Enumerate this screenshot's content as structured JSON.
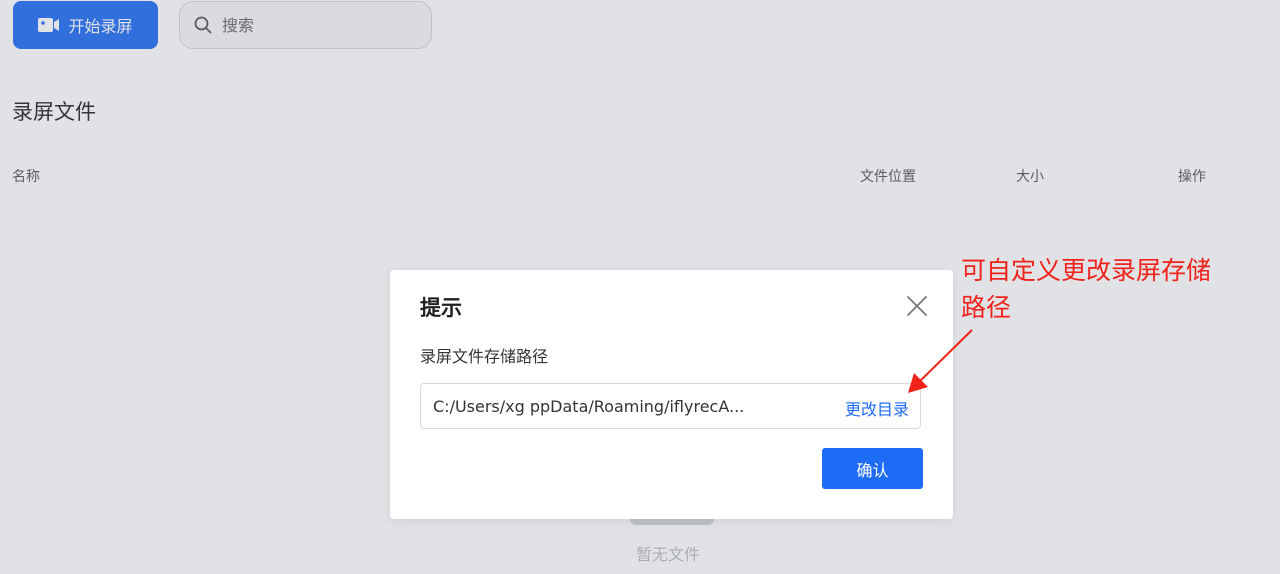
{
  "toolbar": {
    "record_label": "开始录屏",
    "record_icon": "video-camera-icon",
    "search_placeholder": "搜索",
    "search_icon": "search-icon"
  },
  "files": {
    "title": "录屏文件",
    "columns": [
      "名称",
      "文件位置",
      "大小",
      "操作"
    ],
    "empty_text": "暂无文件"
  },
  "dialog": {
    "title": "提示",
    "label": "录屏文件存储路径",
    "path_value": "C:/Users/xg      ppData/Roaming/iflyrecA...",
    "change_dir_label": "更改目录",
    "confirm_label": "确认",
    "close_icon": "close-icon"
  },
  "annotation": {
    "text": "可自定义更改录屏存储路径",
    "color": "#f0221b"
  },
  "colors": {
    "accent": "#1e6cf5"
  }
}
